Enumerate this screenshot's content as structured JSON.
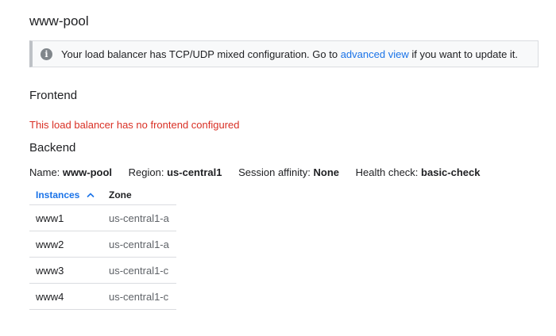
{
  "page": {
    "title": "www-pool"
  },
  "banner": {
    "icon": "info-icon",
    "text_before": "Your load balancer has TCP/UDP mixed configuration. Go to",
    "link_text": "advanced view",
    "text_after": "if you want to update it."
  },
  "frontend": {
    "title": "Frontend",
    "error": "This load balancer has no frontend configured"
  },
  "backend": {
    "title": "Backend",
    "name_label": "Name:",
    "name_value": "www-pool",
    "region_label": "Region:",
    "region_value": "us-central1",
    "affinity_label": "Session affinity:",
    "affinity_value": "None",
    "health_label": "Health check:",
    "health_value": "basic-check"
  },
  "table": {
    "columns": [
      "Instances",
      "Zone"
    ],
    "sort_icon": "chevron-up-icon",
    "rows": [
      {
        "instance": "www1",
        "zone": "us-central1-a"
      },
      {
        "instance": "www2",
        "zone": "us-central1-a"
      },
      {
        "instance": "www3",
        "zone": "us-central1-c"
      },
      {
        "instance": "www4",
        "zone": "us-central1-c"
      }
    ]
  },
  "colors": {
    "link": "#1a73e8",
    "error": "#d93025",
    "border": "#dadce0"
  }
}
